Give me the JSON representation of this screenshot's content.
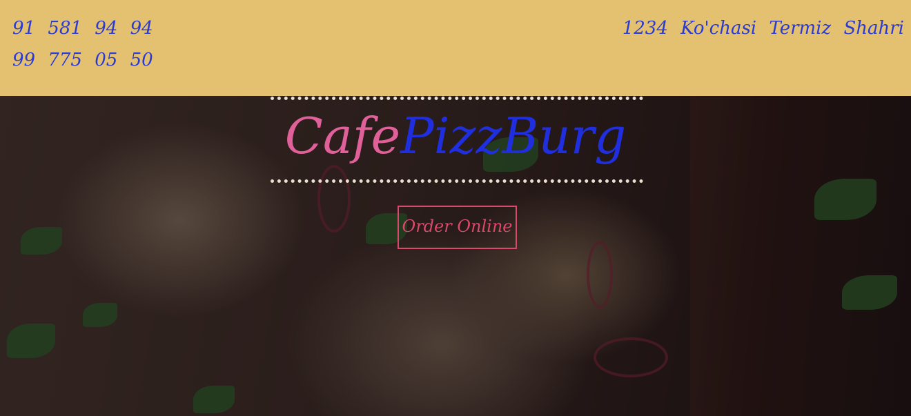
{
  "header": {
    "phones": [
      "91  581  94  94",
      "99  775  05  50"
    ],
    "address": "1234  Ko'chasi  Termiz  Shahri"
  },
  "hero": {
    "brand_part1": "Cafe",
    "brand_part2": "PizzBurg",
    "order_button_label": "Order Online",
    "background_image": "pizza-photo"
  },
  "colors": {
    "topbar": "#e3c171",
    "header_text": "#2b3bd1",
    "brand_cafe": "#e0609a",
    "brand_pizzburg": "#1f2fe0",
    "button": "#d94a6a"
  }
}
